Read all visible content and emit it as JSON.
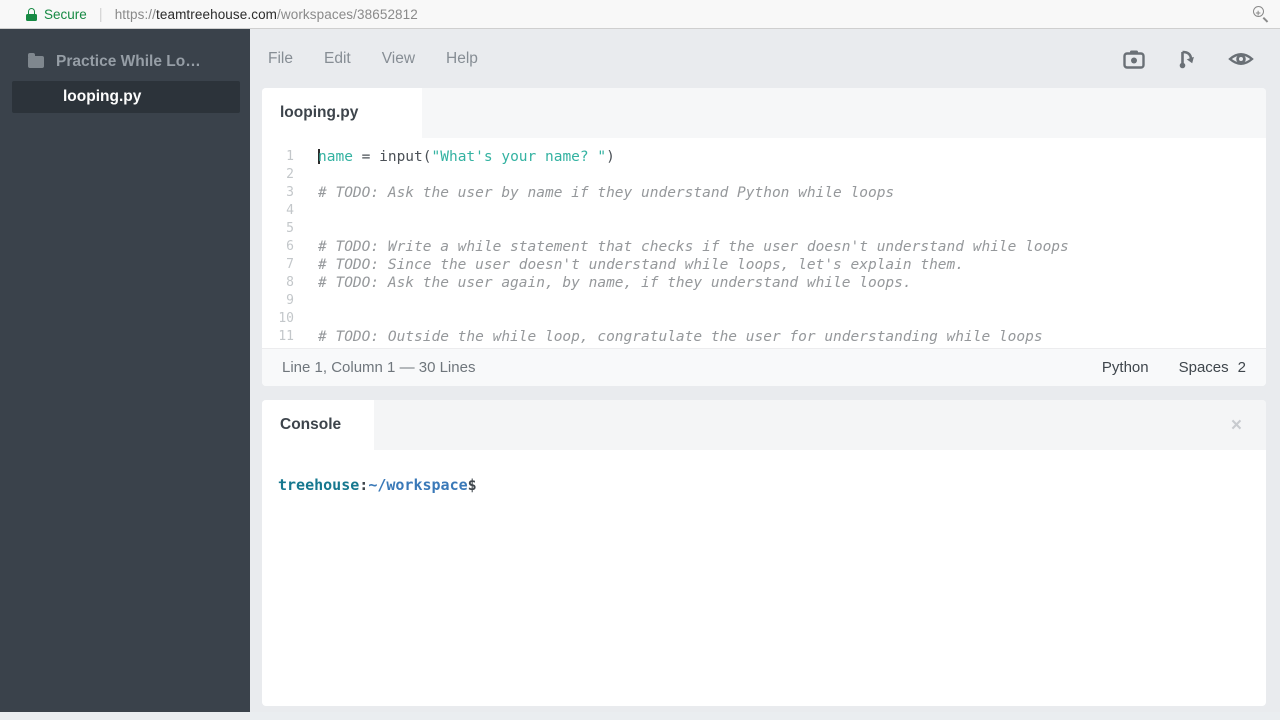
{
  "browser": {
    "security_label": "Secure",
    "url": {
      "scheme": "https://",
      "domain": "teamtreehouse.com",
      "path": "/workspaces/38652812"
    }
  },
  "sidebar": {
    "project_name": "Practice While Lo…",
    "files": [
      {
        "name": "looping.py",
        "selected": true
      }
    ]
  },
  "menubar": {
    "items": [
      "File",
      "Edit",
      "View",
      "Help"
    ],
    "icons": [
      "camera-icon",
      "fork-icon",
      "eye-icon"
    ]
  },
  "editor": {
    "active_tab": "looping.py",
    "lines": [
      {
        "n": 1,
        "cursor": true,
        "segments": [
          {
            "t": "name",
            "c": "v"
          },
          {
            "t": " = input(",
            "c": "p"
          },
          {
            "t": "\"What's your name? \"",
            "c": "v"
          },
          {
            "t": ")",
            "c": "p"
          }
        ]
      },
      {
        "n": 2,
        "segments": []
      },
      {
        "n": 3,
        "segments": [
          {
            "t": "# TODO: Ask the user by name if they understand Python while loops",
            "c": "cm"
          }
        ]
      },
      {
        "n": 4,
        "segments": []
      },
      {
        "n": 5,
        "segments": []
      },
      {
        "n": 6,
        "segments": [
          {
            "t": "# TODO: Write a while statement that checks if the user doesn't understand while loops",
            "c": "cm"
          }
        ]
      },
      {
        "n": 7,
        "segments": [
          {
            "t": "# TODO: Since the user doesn't understand while loops, let's explain them.",
            "c": "cm"
          }
        ]
      },
      {
        "n": 8,
        "segments": [
          {
            "t": "# TODO: Ask the user again, by name, if they understand while loops.",
            "c": "cm"
          }
        ]
      },
      {
        "n": 9,
        "segments": []
      },
      {
        "n": 10,
        "segments": []
      },
      {
        "n": 11,
        "segments": [
          {
            "t": "# TODO: Outside the while loop, congratulate the user for understanding while loops",
            "c": "cm"
          }
        ]
      }
    ],
    "status_bar": {
      "position": "Line 1, Column 1 — 30 Lines",
      "language": "Python",
      "indent_label": "Spaces",
      "indent_value": "2"
    }
  },
  "console": {
    "active_tab": "Console",
    "close_label": "×",
    "prompt_segments": [
      {
        "text": "treehouse",
        "color": "teal"
      },
      {
        "text": ":",
        "color": "plain"
      },
      {
        "text": "~/workspace",
        "color": "blue"
      },
      {
        "text": "$",
        "color": "plain"
      }
    ]
  },
  "colors": {
    "secure_green": "#178a44",
    "sidebar_bg": "#3a424b",
    "sidebar_selected_bg": "#2c333a",
    "code_teal": "#33b2a1",
    "comment_gray": "#95989b",
    "prompt_teal": "#16788f",
    "prompt_blue": "#3a79b8"
  }
}
